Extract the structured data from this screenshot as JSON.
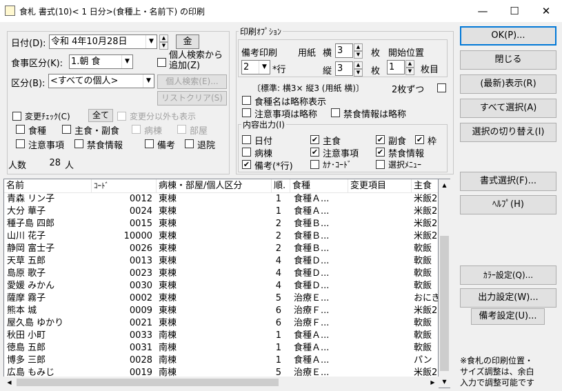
{
  "window": {
    "title": "食札 書式(10)< 1 日分>(食種上・名前下) の印刷",
    "minimize": "—",
    "maximize": "☐",
    "close": "✕"
  },
  "form": {
    "date_label": "日付(D):",
    "date_value": "令和  4年10月28日",
    "weekday": "金",
    "meal_label": "食事区分(K):",
    "meal_value": "1.朝  食",
    "kubun_label": "区分(B):",
    "kubun_value": "<すべての個人>",
    "personal_search_add": "個人検索から追加(Z)",
    "personal_search_btn": "個人検索(E)...",
    "list_clear_btn": "リストクリア(S)",
    "change_check": "変更ﾁｪｯｸ(C)",
    "all_btn": "全て",
    "show_other": "変更分以外も表示",
    "checks_row1": [
      {
        "label": "食種",
        "checked": false,
        "disabled": false
      },
      {
        "label": "主食・副食",
        "checked": false,
        "disabled": false
      },
      {
        "label": "病棟",
        "checked": false,
        "disabled": true
      },
      {
        "label": "部屋",
        "checked": false,
        "disabled": true
      }
    ],
    "checks_row2": [
      {
        "label": "注意事項",
        "checked": false,
        "disabled": false
      },
      {
        "label": "禁食情報",
        "checked": false,
        "disabled": false
      },
      {
        "label": "備考",
        "checked": false,
        "disabled": false
      },
      {
        "label": "退院",
        "checked": false,
        "disabled": false
      }
    ],
    "count_label": "人数",
    "count_value": "28",
    "count_unit": "人"
  },
  "print_options": {
    "group_title": "印刷ｵﾌﾟｼｮﾝ",
    "biko_label": "備考印刷",
    "biko_value": "2",
    "biko_unit": "*行",
    "paper_label": "用紙",
    "yoko_label": "横",
    "yoko_value": "3",
    "yoko_unit": "枚",
    "tate_label": "縦",
    "tate_value": "3",
    "tate_unit": "枚",
    "start_label": "開始位置",
    "start_value": "1",
    "start_unit": "枚目",
    "standard_text": "〔標準: 横3× 縦3 (用紙 横)〕",
    "twoup_label": "2枚ずつ",
    "abbr_shokushu": "食種名は略称表示",
    "abbr_chui": "注意事項は略称",
    "abbr_kinshoku": "禁食情報は略称",
    "content_title": "内容出力(I)",
    "content_items": [
      {
        "label": "日付",
        "checked": false
      },
      {
        "label": "主食",
        "checked": true
      },
      {
        "label": "副食",
        "checked": true
      },
      {
        "label": "枠",
        "checked": true
      },
      {
        "label": "病棟",
        "checked": false
      },
      {
        "label": "注意事項",
        "checked": true
      },
      {
        "label": "禁食情報",
        "checked": true
      },
      {
        "label": "備考(*行)",
        "checked": true
      },
      {
        "label": "ｶﾅ･ｺｰﾄﾞ",
        "checked": false
      },
      {
        "label": "選択ﾒﾆｭｰ",
        "checked": false
      }
    ]
  },
  "buttons": {
    "ok": "OK(P)...",
    "close": "閉じる",
    "refresh": "(最新)表示(R)",
    "select_all": "すべて選択(A)",
    "toggle": "選択の切り替え(I)",
    "format": "書式選択(F)...",
    "help": "ﾍﾙﾌﾟ(H)",
    "color": "ｶﾗｰ設定(Q)...",
    "output": "出力設定(W)...",
    "biko_setting": "備考設定(U)..."
  },
  "note": [
    "※食札の印刷位置・",
    "サイズ調整は、余白",
    "入力で調整可能です"
  ],
  "table": {
    "headers": [
      "名前",
      "ｺｰﾄﾞ",
      "病棟・部屋/個人区分",
      "順.",
      "食種",
      "変更項目",
      "主食"
    ],
    "rows": [
      [
        "青森  リン子",
        "0012",
        "東棟",
        "1",
        "食種Ａ...",
        "",
        "米飯2"
      ],
      [
        "大分  華子",
        "0024",
        "東棟",
        "1",
        "食種Ａ...",
        "",
        "米飯2"
      ],
      [
        "種子島  四郎",
        "0015",
        "東棟",
        "2",
        "食種Ｂ...",
        "",
        "米飯2"
      ],
      [
        "山川  花子",
        "10000",
        "東棟",
        "2",
        "食種Ｂ...",
        "",
        "米飯2"
      ],
      [
        "静岡  富士子",
        "0026",
        "東棟",
        "2",
        "食種Ｂ...",
        "",
        "軟飯"
      ],
      [
        "天草  五郎",
        "0013",
        "東棟",
        "4",
        "食種Ｄ...",
        "",
        "軟飯"
      ],
      [
        "島原  歌子",
        "0023",
        "東棟",
        "4",
        "食種Ｄ...",
        "",
        "軟飯"
      ],
      [
        "愛媛  みかん",
        "0030",
        "東棟",
        "4",
        "食種Ｄ...",
        "",
        "軟飯"
      ],
      [
        "薩摩  霧子",
        "0002",
        "東棟",
        "5",
        "治療Ｅ...",
        "",
        "おにぎ"
      ],
      [
        "熊本  城",
        "0009",
        "東棟",
        "6",
        "治療Ｆ...",
        "",
        "米飯2"
      ],
      [
        "屋久島  ゆかり",
        "0021",
        "東棟",
        "6",
        "治療Ｆ...",
        "",
        "軟飯"
      ],
      [
        "秋田  小町",
        "0033",
        "南棟",
        "1",
        "食種Ａ...",
        "",
        "軟飯"
      ],
      [
        "徳島  五郎",
        "0031",
        "南棟",
        "1",
        "食種Ａ...",
        "",
        "軟飯"
      ],
      [
        "博多  三郎",
        "0028",
        "南棟",
        "1",
        "食種Ａ...",
        "",
        "パン"
      ],
      [
        "広島  もみじ",
        "0019",
        "南棟",
        "5",
        "治療Ｅ...",
        "",
        "米飯2"
      ]
    ]
  }
}
